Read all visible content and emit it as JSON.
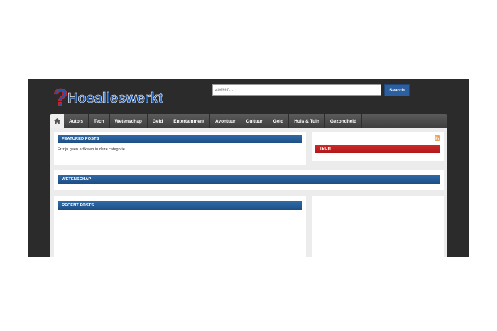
{
  "site": {
    "logo_text": "Hoealleswerkt",
    "logo_q_mark": "?"
  },
  "search": {
    "placeholder": "Zoeken...",
    "button_label": "Search"
  },
  "nav": {
    "home_icon": "home-icon",
    "items": [
      {
        "label": "Auto's"
      },
      {
        "label": "Tech"
      },
      {
        "label": "Wetenschap"
      },
      {
        "label": "Geld"
      },
      {
        "label": "Entertainment"
      },
      {
        "label": "Avontuur"
      },
      {
        "label": "Cultuur"
      },
      {
        "label": "Geld"
      },
      {
        "label": "Huis & Tuin"
      },
      {
        "label": "Gezondheid"
      }
    ]
  },
  "featured": {
    "title": "FEATURED POSTS",
    "empty_message": "Er zijn geen artikelen in deze categorie"
  },
  "tech_widget": {
    "title": "TECH"
  },
  "wetenschap": {
    "title": "WETENSCHAP"
  },
  "recent": {
    "title": "RECENT POSTS"
  },
  "colors": {
    "accent_blue": "#2c5fa0",
    "accent_red": "#c52020",
    "frame_bg": "#2b2b2b"
  }
}
